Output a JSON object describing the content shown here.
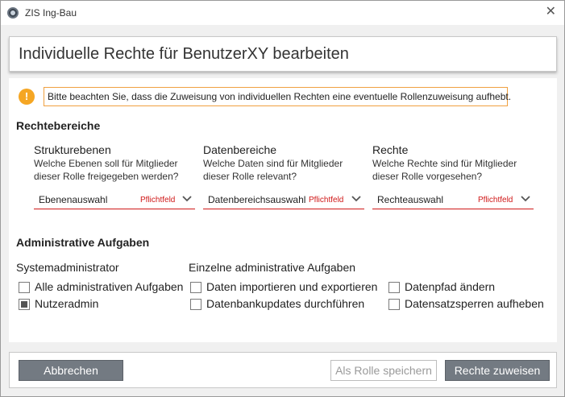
{
  "window": {
    "app_title": "ZIS Ing-Bau",
    "close_symbol": "✕"
  },
  "header": {
    "title": "Individuelle Rechte für BenutzerXY bearbeiten"
  },
  "notice": {
    "icon": "exclamation-icon",
    "text": "Bitte beachten Sie, dass die Zuweisung von individuellen Rechten eine eventuelle Rollenzuweisung aufhebt.",
    "accent": "#f5a623"
  },
  "rights_section": {
    "title": "Rechtebereiche",
    "columns": [
      {
        "title": "Strukturebenen",
        "desc_line1": "Welche Ebenen soll für Mitglieder",
        "desc_line2": "dieser Rolle freigegeben werden?",
        "select_value": "Ebenenauswahl",
        "required": "Pflichtfeld"
      },
      {
        "title": "Datenbereiche",
        "desc_line1": "Welche Daten sind für Mitglieder",
        "desc_line2": "dieser Rolle relevant?",
        "select_value": "Datenbereichsauswahl",
        "required": "Pflichtfeld"
      },
      {
        "title": "Rechte",
        "desc_line1": "Welche Rechte sind für Mitglieder",
        "desc_line2": "dieser Rolle vorgesehen?",
        "select_value": "Rechteauswahl",
        "required": "Pflichtfeld"
      }
    ],
    "required_color": "#d01818"
  },
  "admin_section": {
    "title": "Administrative Aufgaben",
    "sysadmin": {
      "label": "Systemadministrator",
      "items": [
        {
          "label": "Alle administrativen Aufgaben",
          "checked": false
        },
        {
          "label": "Nutzeradmin",
          "checked": true
        }
      ]
    },
    "individual": {
      "label": "Einzelne administrative Aufgaben",
      "items": [
        {
          "label": "Daten importieren und exportieren",
          "checked": false
        },
        {
          "label": "Datenbankupdates durchführen",
          "checked": false
        },
        {
          "label": "Datenpfad ändern",
          "checked": false
        },
        {
          "label": "Datensatzsperren aufheben",
          "checked": false
        }
      ]
    }
  },
  "footer": {
    "cancel_label": "Abbrechen",
    "save_role_label": "Als Rolle speichern",
    "assign_label": "Rechte zuweisen"
  }
}
